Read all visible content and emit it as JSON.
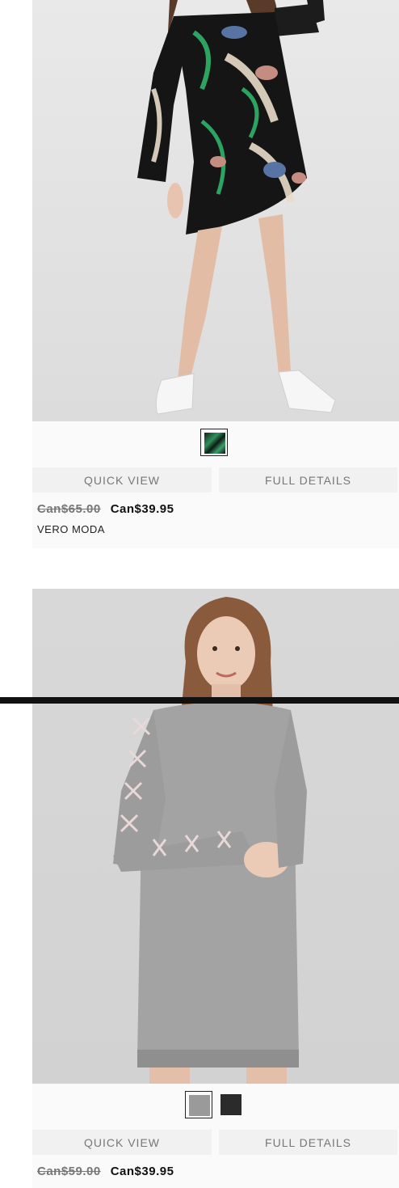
{
  "products": [
    {
      "image_alt": "printed dress",
      "swatches": [
        {
          "color": "#1a3a2a",
          "selected": true
        }
      ],
      "quick_view_label": "QUICK VIEW",
      "full_details_label": "FULL DETAILS",
      "old_price": "Can$65.00",
      "new_price": "Can$39.95",
      "brand": "VERO MODA"
    },
    {
      "image_alt": "sweatshirt dress",
      "swatches": [
        {
          "color": "#9a9a9a",
          "selected": true
        },
        {
          "color": "#2b2b2b",
          "selected": false
        }
      ],
      "quick_view_label": "QUICK VIEW",
      "full_details_label": "FULL DETAILS",
      "old_price": "Can$59.00",
      "new_price": "Can$39.95",
      "brand": ""
    }
  ],
  "colors": {
    "info_bg": "#fafafa",
    "button_bg": "#f1f1f1",
    "button_text": "#777777",
    "separator": "#111111"
  }
}
